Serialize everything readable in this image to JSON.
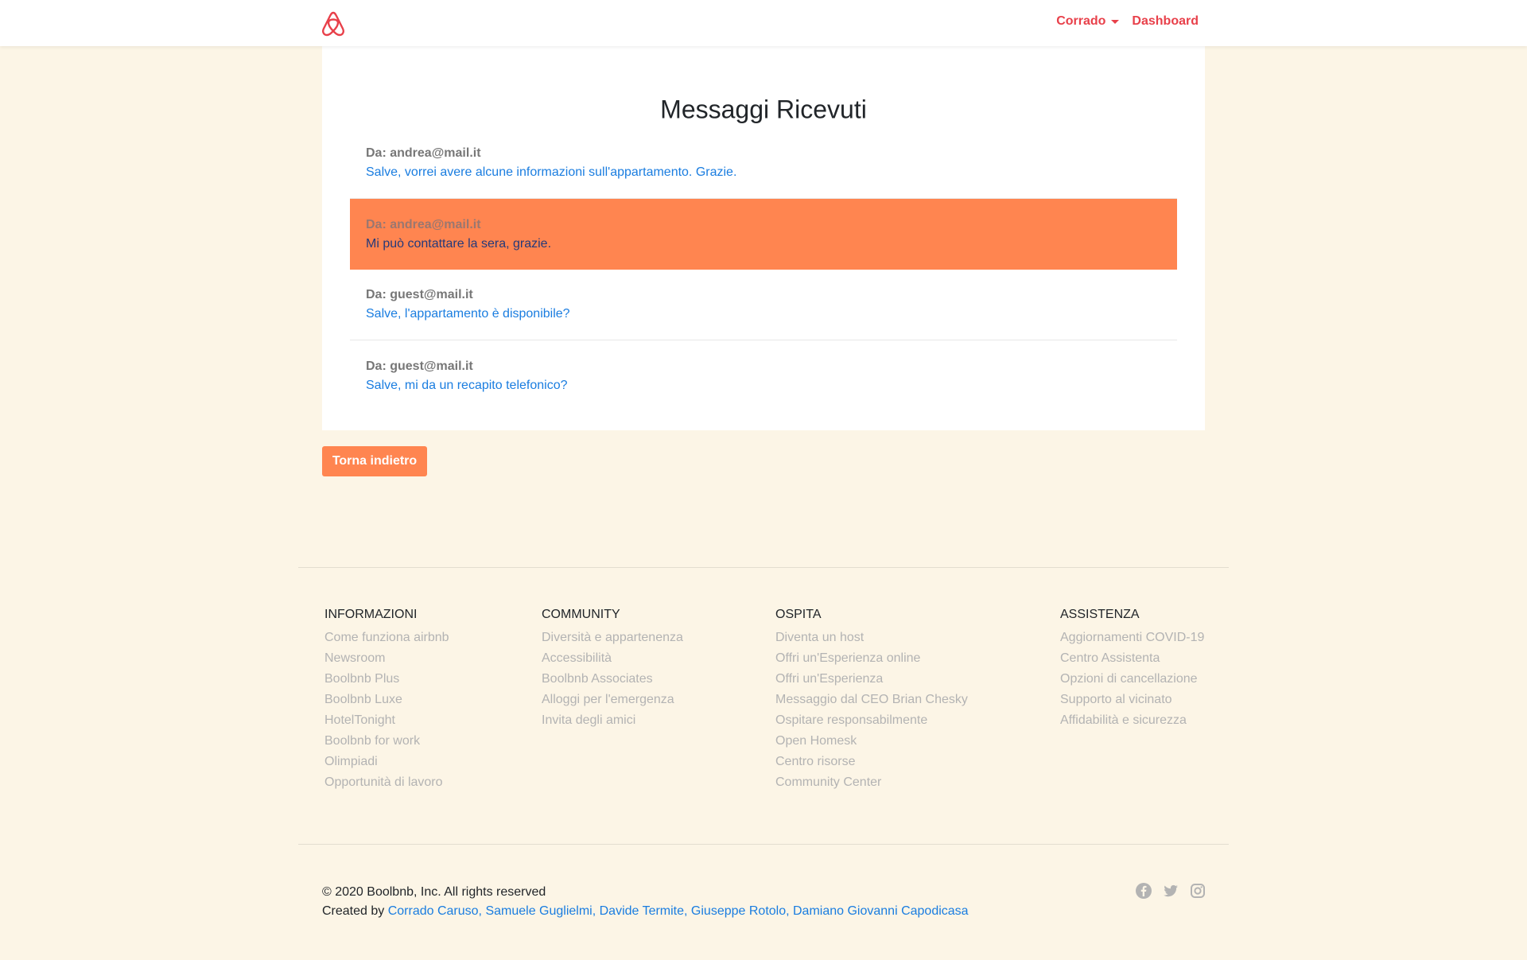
{
  "navbar": {
    "logo_icon": "airbnb-logo-icon",
    "user_label": "Corrado",
    "dashboard_label": "Dashboard",
    "accent_color": "#e8404a"
  },
  "main": {
    "title": "Messaggi Ricevuti",
    "messages": [
      {
        "from": "Da: andrea@mail.it",
        "text": "Salve, vorrei avere alcune informazioni sull'appartamento. Grazie."
      },
      {
        "from": "Da: andrea@mail.it",
        "text": "Mi può contattare la sera, grazie."
      },
      {
        "from": "Da: guest@mail.it",
        "text": "Salve, l'appartamento è disponibile?"
      },
      {
        "from": "Da: guest@mail.it",
        "text": "Salve, mi da un recapito telefonico?"
      }
    ],
    "back_label": "Torna indietro",
    "highlight_color": "#ff8550"
  },
  "footer": {
    "columns": [
      {
        "title": "INFORMAZIONI",
        "links": [
          "Come funziona airbnb",
          "Newsroom",
          "Boolbnb Plus",
          "Boolbnb Luxe",
          "HotelTonight",
          "Boolbnb for work",
          "Olimpiadi",
          "Opportunità di lavoro"
        ]
      },
      {
        "title": "COMMUNITY",
        "links": [
          "Diversità e appartenenza",
          "Accessibilità",
          "Boolbnb Associates",
          "Alloggi per l'emergenza",
          "Invita degli amici"
        ]
      },
      {
        "title": "OSPITA",
        "links": [
          "Diventa un host",
          "Offri un'Esperienza online",
          "Offri un'Esperienza",
          "Messaggio dal CEO Brian Chesky",
          "Ospitare responsabilmente",
          "Open Homesk",
          "Centro risorse",
          "Community Center"
        ]
      },
      {
        "title": "ASSISTENZA",
        "links": [
          "Aggiornamenti COVID-19",
          "Centro Assistenta",
          "Opzioni di cancellazione",
          "Supporto al vicinato",
          "Affidabilità e sicurezza"
        ]
      }
    ],
    "copyright": "© 2020 Boolbnb, Inc. All rights reserved",
    "created_by_label": "Created by",
    "authors": [
      "Corrado Caruso",
      "Samuele Guglielmi",
      "Davide Termite",
      "Giuseppe Rotolo",
      "Damiano Giovanni Capodicasa"
    ],
    "social_icons": [
      "facebook-icon",
      "twitter-icon",
      "instagram-icon"
    ]
  }
}
